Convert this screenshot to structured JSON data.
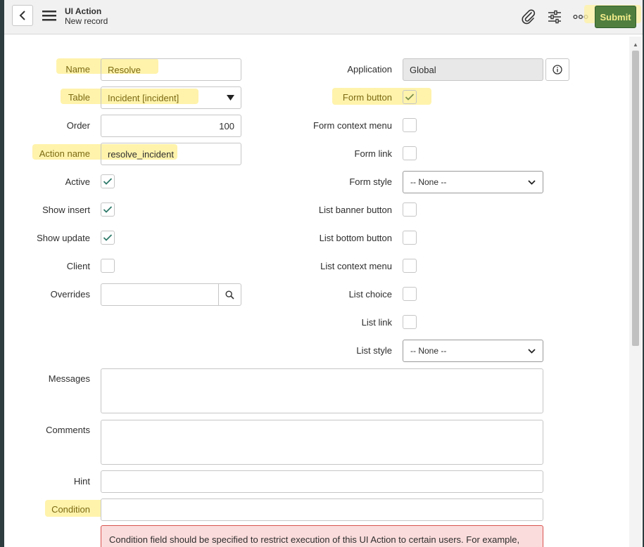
{
  "header": {
    "title": "UI Action",
    "subtitle": "New record",
    "submit_label": "Submit"
  },
  "left_fields": {
    "name": {
      "label": "Name",
      "value": "Resolve"
    },
    "table": {
      "label": "Table",
      "value": "Incident [incident]"
    },
    "order": {
      "label": "Order",
      "value": "100"
    },
    "action_name": {
      "label": "Action name",
      "value": "resolve_incident"
    },
    "active": {
      "label": "Active",
      "checked": true
    },
    "show_insert": {
      "label": "Show insert",
      "checked": true
    },
    "show_update": {
      "label": "Show update",
      "checked": true
    },
    "client": {
      "label": "Client",
      "checked": false
    },
    "overrides": {
      "label": "Overrides",
      "value": ""
    }
  },
  "right_fields": {
    "application": {
      "label": "Application",
      "value": "Global"
    },
    "form_button": {
      "label": "Form button",
      "checked": true
    },
    "form_context_menu": {
      "label": "Form context menu",
      "checked": false
    },
    "form_link": {
      "label": "Form link",
      "checked": false
    },
    "form_style": {
      "label": "Form style",
      "value": "-- None --"
    },
    "list_banner_button": {
      "label": "List banner button",
      "checked": false
    },
    "list_bottom_button": {
      "label": "List bottom button",
      "checked": false
    },
    "list_context_menu": {
      "label": "List context menu",
      "checked": false
    },
    "list_choice": {
      "label": "List choice",
      "checked": false
    },
    "list_link": {
      "label": "List link",
      "checked": false
    },
    "list_style": {
      "label": "List style",
      "value": "-- None --"
    }
  },
  "wide_fields": {
    "messages": {
      "label": "Messages",
      "value": ""
    },
    "comments": {
      "label": "Comments",
      "value": ""
    },
    "hint": {
      "label": "Hint",
      "value": ""
    },
    "condition": {
      "label": "Condition",
      "value": ""
    }
  },
  "alert": {
    "text": "Condition field should be specified to restrict execution of this UI Action to certain users. For example,"
  },
  "colors": {
    "highlight": "#fff2a8",
    "submit_bg": "#4f7e3f",
    "check": "#2f7a6a",
    "alert_bg": "#fbdcdc",
    "alert_border": "#d9534f"
  }
}
